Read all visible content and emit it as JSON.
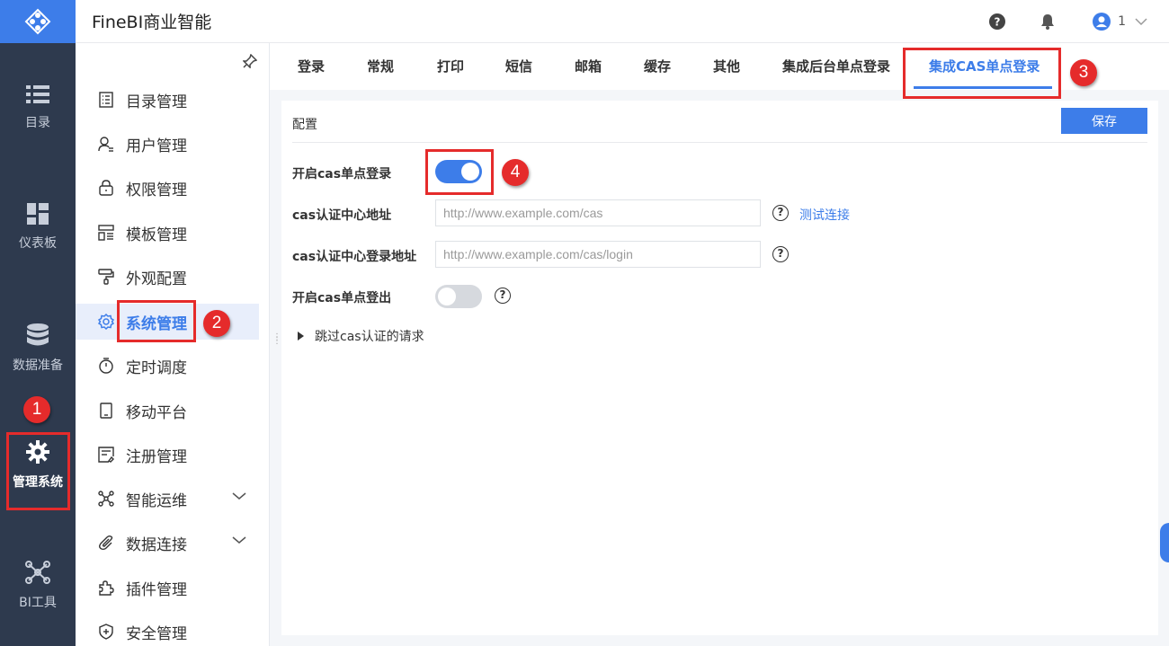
{
  "app": {
    "title": "FineBI商业智能",
    "user_label": "1"
  },
  "rail": {
    "items": [
      {
        "label": "目录",
        "icon": "list-icon"
      },
      {
        "label": "仪表板",
        "icon": "dashboard-icon"
      },
      {
        "label": "数据准备",
        "icon": "database-icon"
      },
      {
        "label": "管理系统",
        "icon": "gear-icon",
        "active": true
      },
      {
        "label": "BI工具",
        "icon": "network-icon"
      }
    ]
  },
  "sidebar": {
    "items": [
      {
        "label": "目录管理",
        "icon": "catalog-icon"
      },
      {
        "label": "用户管理",
        "icon": "user-icon"
      },
      {
        "label": "权限管理",
        "icon": "lock-icon"
      },
      {
        "label": "模板管理",
        "icon": "template-icon"
      },
      {
        "label": "外观配置",
        "icon": "brush-icon"
      },
      {
        "label": "系统管理",
        "icon": "gear-icon",
        "active": true
      },
      {
        "label": "定时调度",
        "icon": "timer-icon"
      },
      {
        "label": "移动平台",
        "icon": "tablet-icon"
      },
      {
        "label": "注册管理",
        "icon": "register-icon"
      },
      {
        "label": "智能运维",
        "icon": "ops-icon",
        "expandable": true
      },
      {
        "label": "数据连接",
        "icon": "paperclip-icon",
        "expandable": true
      },
      {
        "label": "插件管理",
        "icon": "puzzle-icon"
      },
      {
        "label": "安全管理",
        "icon": "shield-icon"
      }
    ]
  },
  "tabs": [
    "登录",
    "常规",
    "打印",
    "短信",
    "邮箱",
    "缓存",
    "其他",
    "集成后台单点登录",
    "集成CAS单点登录"
  ],
  "active_tab": "集成CAS单点登录",
  "config": {
    "title": "配置",
    "save_label": "保存",
    "enable_sso_label": "开启cas单点登录",
    "enable_sso": true,
    "cas_url_label": "cas认证中心地址",
    "cas_url_placeholder": "http://www.example.com/cas",
    "test_link": "测试连接",
    "cas_login_label": "cas认证中心登录地址",
    "cas_login_placeholder": "http://www.example.com/cas/login",
    "enable_logout_label": "开启cas单点登出",
    "enable_logout": false,
    "skip_label": "跳过cas认证的请求"
  },
  "annotations": [
    "1",
    "2",
    "3",
    "4"
  ],
  "colors": {
    "accent": "#3d7de9",
    "rail": "#2e3a4e",
    "annotation": "#e52b2b"
  }
}
